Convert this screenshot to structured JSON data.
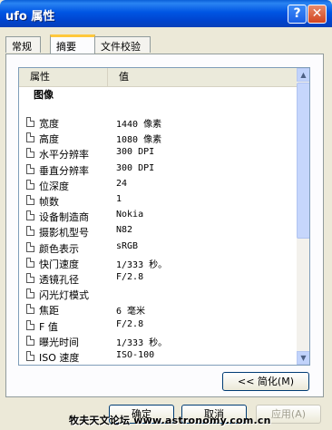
{
  "window": {
    "title": "ufo 属性",
    "help_glyph": "?",
    "close_glyph": "✕"
  },
  "tabs": [
    {
      "label": "常规",
      "active": false
    },
    {
      "label": "摘要",
      "active": true
    },
    {
      "label": "文件校验",
      "active": false
    }
  ],
  "list": {
    "columns": [
      "属性",
      "值"
    ],
    "group": "图像",
    "rows": [
      {
        "prop": "宽度",
        "value": "1440 像素"
      },
      {
        "prop": "高度",
        "value": "1080 像素"
      },
      {
        "prop": "水平分辨率",
        "value": "300 DPI"
      },
      {
        "prop": "垂直分辨率",
        "value": "300 DPI"
      },
      {
        "prop": "位深度",
        "value": "24"
      },
      {
        "prop": "帧数",
        "value": "1"
      },
      {
        "prop": "设备制造商",
        "value": "Nokia"
      },
      {
        "prop": "摄影机型号",
        "value": "N82"
      },
      {
        "prop": "颜色表示",
        "value": "sRGB"
      },
      {
        "prop": "快门速度",
        "value": "1/333 秒。"
      },
      {
        "prop": "透镜孔径",
        "value": "F/2.8"
      },
      {
        "prop": "闪光灯模式",
        "value": ""
      },
      {
        "prop": "焦距",
        "value": "6 毫米"
      },
      {
        "prop": "F 值",
        "value": "F/2.8"
      },
      {
        "prop": "曝光时间",
        "value": "1/333 秒。"
      },
      {
        "prop": "ISO 速度",
        "value": "ISO-100"
      }
    ]
  },
  "buttons": {
    "simplify": "<< 简化(M)",
    "ok": "确定",
    "cancel": "取消",
    "apply": "应用(A)"
  },
  "watermark": "牧夫天文论坛 www.astronomy.com.cn",
  "colors": {
    "titlebar": "#0055e3",
    "active_tab_accent": "#ffc83c",
    "dialog_bg": "#ece9d8"
  }
}
